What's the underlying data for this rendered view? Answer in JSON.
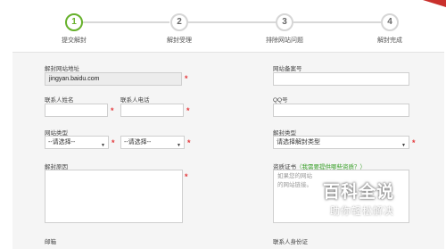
{
  "steps": [
    {
      "num": "1",
      "label": "提交解封"
    },
    {
      "num": "2",
      "label": "解封受理"
    },
    {
      "num": "3",
      "label": "排除网站问题"
    },
    {
      "num": "4",
      "label": "解封完成"
    }
  ],
  "form": {
    "site_url_label": "解封网站地址",
    "site_url_value": "jingyan.baidu.com",
    "icp_label": "网站备案号",
    "contact_name_label": "联系人姓名",
    "contact_phone_label": "联系人电话",
    "qq_label": "QQ号",
    "site_type_label": "网站类型",
    "site_type_select1": "--请选择--",
    "site_type_select2": "--请选择--",
    "unblock_type_label": "解封类型",
    "unblock_type_select": "请选择解封类型",
    "reason_label": "解封原因",
    "cert_label": "资质证书",
    "cert_link": "（我需要提供哪些资质？）",
    "cert_placeholder_line1": "如果您的网站",
    "cert_placeholder_line2": "的网站链接。",
    "email_label": "邮箱",
    "id_label": "联系人身份证",
    "required_mark": "*"
  },
  "watermark": {
    "title": "百科全说",
    "subtitle": "助你轻松解决"
  },
  "colors": {
    "active_step": "#66b12b",
    "required": "#e4393c",
    "link": "#3aa02a"
  }
}
